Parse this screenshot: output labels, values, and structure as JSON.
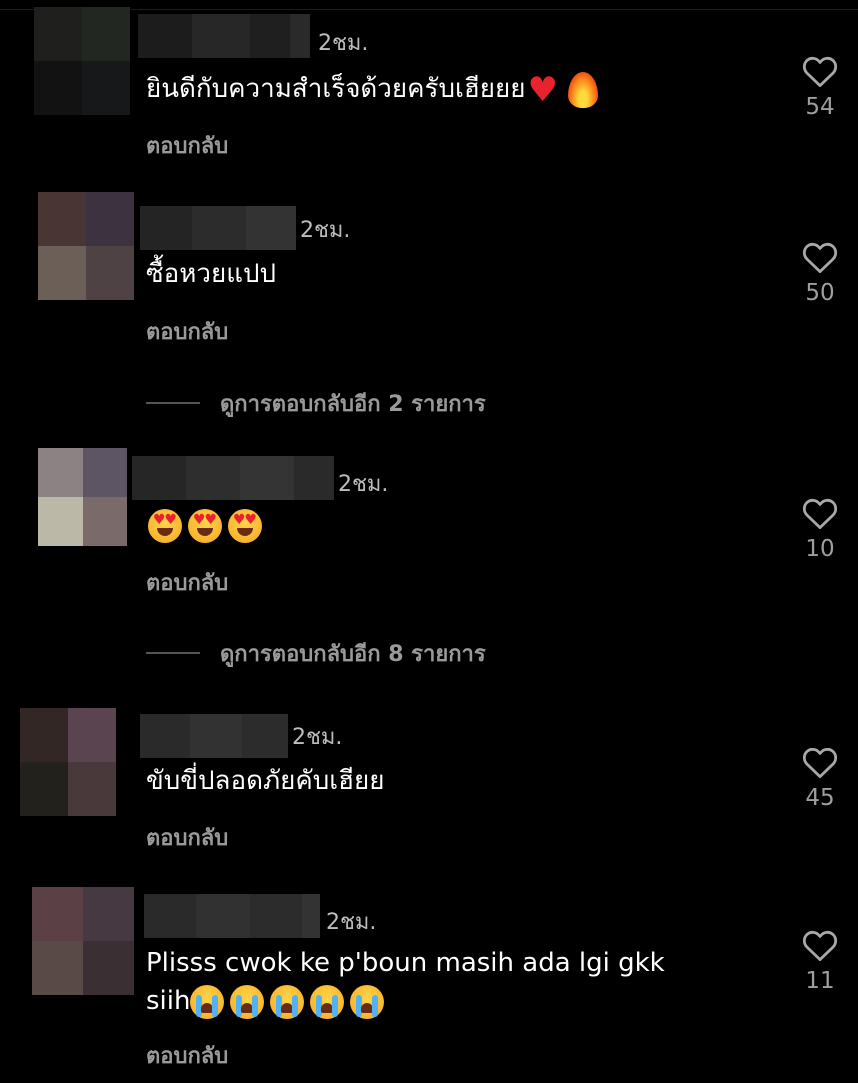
{
  "comments": [
    {
      "time": "2ชม.",
      "text": "ยินดีกับความสำเร็จด้วยครับเฮียยย",
      "emoji_suffix": [
        "red-heart",
        "fire"
      ],
      "reply_label": "ตอบกลับ",
      "likes": "54",
      "avatar_colors": [
        "#1f1f1d",
        "#232721",
        "#121212",
        "#17181a"
      ],
      "name_blur_colors": [
        "#1c1c1c",
        "#272727",
        "#1f1f1f",
        "#2a2a2a"
      ]
    },
    {
      "time": "2ชม.",
      "text": "ซื้อหวยแปป",
      "reply_label": "ตอบกลับ",
      "likes": "50",
      "avatar_colors": [
        "#4a3535",
        "#3d3340",
        "#6b5f58",
        "#4f4245"
      ],
      "name_blur_colors": [
        "#242424",
        "#2c2c2c",
        "#333333"
      ]
    },
    {
      "time": "2ชม.",
      "text": "",
      "emoji_suffix": [
        "heart-eyes",
        "heart-eyes",
        "heart-eyes"
      ],
      "reply_label": "ตอบกลับ",
      "likes": "10",
      "avatar_colors": [
        "#8c8283",
        "#5d5563",
        "#bcb8a7",
        "#7b6a6a"
      ],
      "name_blur_colors": [
        "#262626",
        "#2e2e2e",
        "#343434",
        "#2a2a2a"
      ]
    },
    {
      "time": "2ชม.",
      "text": "ขับขี่ปลอดภัยคับเฮียย",
      "reply_label": "ตอบกลับ",
      "likes": "45",
      "avatar_colors": [
        "#332726",
        "#5a4450",
        "#22211c",
        "#4a393a"
      ],
      "name_blur_colors": [
        "#2a2a2a",
        "#323232",
        "#2c2c2c"
      ]
    },
    {
      "time": "2ชม.",
      "text_line1": "Plisss cwok ke p'boun masih ada lgi gkk",
      "text_line2": "siih",
      "emoji_suffix": [
        "crying",
        "crying",
        "crying",
        "crying",
        "crying"
      ],
      "reply_label": "ตอบกลับ",
      "likes": "11",
      "avatar_colors": [
        "#5b4146",
        "#463942",
        "#5a4a47",
        "#3a2f33"
      ],
      "name_blur_colors": [
        "#2a2a2a",
        "#313131",
        "#2c2c2c",
        "#333333"
      ]
    }
  ],
  "view_more": [
    {
      "label": "ดูการตอบกลับอีก 2 รายการ"
    },
    {
      "label": "ดูการตอบกลับอีก 8 รายการ"
    }
  ],
  "icons": {
    "like": "heart-outline-icon"
  }
}
